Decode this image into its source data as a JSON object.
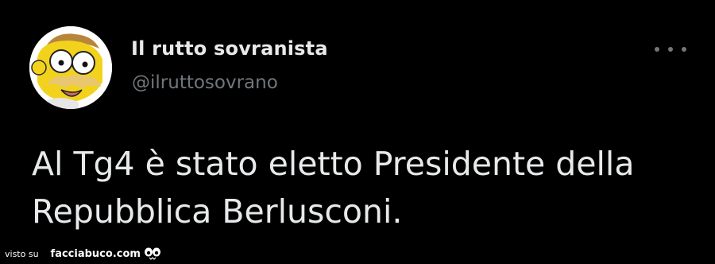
{
  "tweet": {
    "display_name": "Il rutto sovranista",
    "handle": "@ilruttosovrano",
    "text": "Al Tg4 è stato eletto Presidente della\nRepubblica Berlusconi.",
    "avatar_icon": "cartoon-face-avatar",
    "more_icon": "more-dots-icon"
  },
  "watermark": {
    "prefix": "visto su",
    "site": "facciabuco.com",
    "logo_icon": "eyes-logo"
  },
  "colors": {
    "background": "#000000",
    "primary_text": "#e7e9ea",
    "secondary_text": "#71767b"
  }
}
